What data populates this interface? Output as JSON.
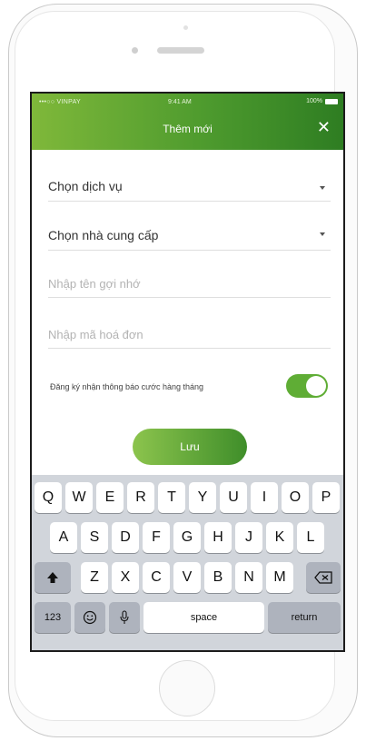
{
  "status_bar": {
    "carrier": "•••○○ VINPAY",
    "time": "9:41 AM",
    "battery": "100%"
  },
  "header": {
    "title": "Thêm mới",
    "close_glyph": "✕"
  },
  "form": {
    "service_select": "Chọn dịch vụ",
    "provider_select": "Chọn nhà cung cấp",
    "nickname_placeholder": "Nhập tên gợi nhớ",
    "bill_code_placeholder": "Nhập mã hoá đơn",
    "notify_label": "Đăng ký nhận thông báo cước hàng tháng",
    "notify_enabled": true
  },
  "save_button": "Lưu",
  "keyboard": {
    "row1": [
      "Q",
      "W",
      "E",
      "R",
      "T",
      "Y",
      "U",
      "I",
      "O",
      "P"
    ],
    "row2": [
      "A",
      "S",
      "D",
      "F",
      "G",
      "H",
      "J",
      "K",
      "L"
    ],
    "row3": [
      "Z",
      "X",
      "C",
      "V",
      "B",
      "N",
      "M"
    ],
    "num_key": "123",
    "space_key": "space",
    "return_key": "return"
  },
  "colors": {
    "accent_green": "#5fad35",
    "header_dark_green": "#2e7d22"
  }
}
